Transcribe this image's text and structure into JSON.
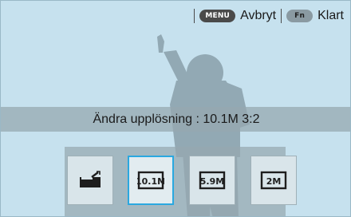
{
  "topbar": {
    "menu_key": "MENU",
    "cancel_label": "Avbryt",
    "fn_key": "Fn",
    "done_label": "Klart"
  },
  "status": {
    "text": "Ändra upplösning : 10.1M 3:2"
  },
  "resolution_options": [
    {
      "icon": "custom-ratio-icon",
      "label": "",
      "selected": false
    },
    {
      "icon": "resolution-10-1m-icon",
      "label": "10.1M",
      "selected": true
    },
    {
      "icon": "resolution-5-9m-icon",
      "label": "5.9M",
      "selected": false
    },
    {
      "icon": "resolution-2m-icon",
      "label": "2M",
      "selected": false
    }
  ],
  "colors": {
    "background": "#c6e1ee",
    "selection": "#2aa8e0",
    "key_dark": "#4a4a4a",
    "key_fn": "#8a9aa2"
  }
}
